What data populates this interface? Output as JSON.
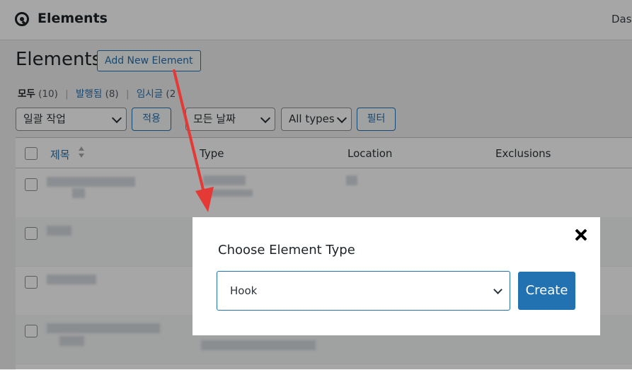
{
  "header": {
    "brand": "Elements",
    "dashboard_link": "Dash"
  },
  "page": {
    "title": "Elements",
    "add_new_label": "Add New Element"
  },
  "filters": {
    "views": [
      {
        "label": "모두",
        "count": "(10)"
      },
      {
        "label": "발행됨",
        "count": "(8)"
      },
      {
        "label": "임시글",
        "count": "(2"
      }
    ],
    "bulk_action": "일괄 작업",
    "apply_label": "적용",
    "date_filter": "모든 날짜",
    "type_filter": "All types",
    "filter_label": "필터"
  },
  "table": {
    "columns": [
      "제목",
      "Type",
      "Location",
      "Exclusions"
    ]
  },
  "modal": {
    "title": "Choose Element Type",
    "selected_type": "Hook",
    "create_label": "Create"
  },
  "colors": {
    "accent": "#2271b1",
    "annotation_arrow": "#e53935"
  }
}
